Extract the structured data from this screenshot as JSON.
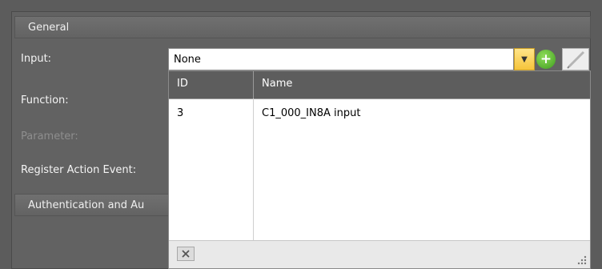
{
  "general": {
    "header": "General",
    "input_label": "Input:",
    "function_label": "Function:",
    "parameter_label": "Parameter:",
    "register_label": "Register Action Event:"
  },
  "input": {
    "value": "None"
  },
  "icons": {
    "dropdown": "chevron-down-icon",
    "add": "plus-circle-icon",
    "edit": "pencil-icon",
    "clear": "clear-filter-icon",
    "grip": "resize-grip-icon"
  },
  "colors": {
    "dropdown_button": "#f6c43a",
    "add_button": "#4caf28",
    "grid_header": "#5d5d5d"
  },
  "popup": {
    "columns": {
      "id": "ID",
      "name": "Name"
    },
    "rows": [
      {
        "id": "3",
        "name": "C1_000_IN8A input"
      }
    ]
  },
  "auth": {
    "header": "Authentication and Au"
  }
}
